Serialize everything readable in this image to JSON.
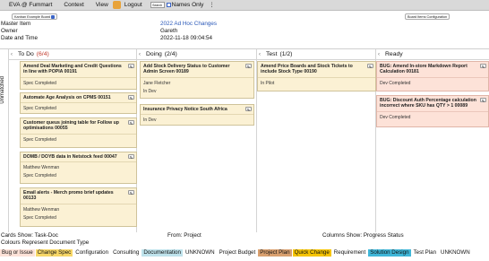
{
  "menubar": {
    "items": [
      "EVA @ Fummart",
      "Context",
      "View",
      "Logout"
    ],
    "search_label": "Search",
    "names_only_label": "Names Only",
    "kebab": "⋮"
  },
  "toolbar": {
    "kanban_button": "Kanban Example Board",
    "board_config_button": "Board Items Configuration"
  },
  "meta": {
    "master_item_label": "Master Item",
    "master_item_value": "2022 Ad Hoc Changes",
    "owner_label": "Owner",
    "owner_value": "Gareth",
    "datetime_label": "Date and Time",
    "datetime_value": "2022-11-18 09:04:54"
  },
  "swimlane": {
    "label": "Unmatched"
  },
  "columns": [
    {
      "name": "To Do",
      "count": "(6/4)",
      "over_limit": true,
      "chevron": "‹"
    },
    {
      "name": "Doing",
      "count": "(2/4)",
      "over_limit": false,
      "chevron": "‹"
    },
    {
      "name": "Test",
      "count": "(1/2)",
      "over_limit": false,
      "chevron": "‹"
    },
    {
      "name": "Ready",
      "count": "",
      "over_limit": false,
      "chevron": "‹"
    }
  ],
  "cards": {
    "todo": [
      {
        "title": "Amend Deal Marketing and Credit Questions in line with POPIA 00191",
        "lines": [
          "Spec Completed"
        ]
      },
      {
        "title": "Automate Age Analysis on CPMS 00151",
        "lines": [
          "Spec Completed"
        ]
      },
      {
        "title": "Customer queus joining table for Follow up optimisations 00055",
        "lines": [
          "Spec Completed"
        ]
      },
      {
        "title": "DOMB / DOYB data in Netstock feed 00047",
        "lines": [
          "Matthew Wenman",
          "Spec Completed"
        ]
      },
      {
        "title": "Email alerts - Merch promo brief updates 00133",
        "lines": [
          "Matthew Wenman",
          "Spec Completed"
        ]
      }
    ],
    "doing": [
      {
        "title": "Add Stock Delivery Status to Customer Admin Screen 00189",
        "lines": [
          "Jane Fletcher",
          "In Dev"
        ]
      },
      {
        "title": "Insurance Privacy Notice South Africa",
        "lines": [
          "In Dev"
        ]
      }
    ],
    "test": [
      {
        "title": "Amend Price Boards and Stock Tickets to include Stock Type 00190",
        "lines": [
          "In Pilot"
        ]
      }
    ],
    "ready": [
      {
        "title": "BUG: Amend In-store Markdown Report Calculation 00181",
        "lines": [
          "Dev Completed"
        ]
      },
      {
        "title": "BUG: Discount Auth Percentage calculation incorrect where SKU has QTY > 1 00089",
        "lines": [
          "Dev Completed"
        ]
      }
    ],
    "edit_glyph": "✎"
  },
  "footer": {
    "cards_show": "Cards Show: Task-Doc",
    "from": "From: Project",
    "columns_show": "Columns Show: Progress Status",
    "colours_label": "Colours Represent Document Type"
  },
  "legend": [
    {
      "label": "Bug or Issue",
      "color": "#fde2d8"
    },
    {
      "label": "Change Spec",
      "color": "#f7d768"
    },
    {
      "label": "Configuration",
      "color": ""
    },
    {
      "label": "Consulting",
      "color": ""
    },
    {
      "label": "Documentation",
      "color": "#bfe3ec"
    },
    {
      "label": "UNKNOWN",
      "color": ""
    },
    {
      "label": "Project Budget",
      "color": ""
    },
    {
      "label": "Project Plan",
      "color": "#d9a06f"
    },
    {
      "label": "Quick Change",
      "color": "#f6c400"
    },
    {
      "label": "Requirement",
      "color": ""
    },
    {
      "label": "Solution Design",
      "color": "#3fb6d8"
    },
    {
      "label": "Test Plan",
      "color": ""
    },
    {
      "label": "UNKNOWN",
      "color": ""
    }
  ]
}
